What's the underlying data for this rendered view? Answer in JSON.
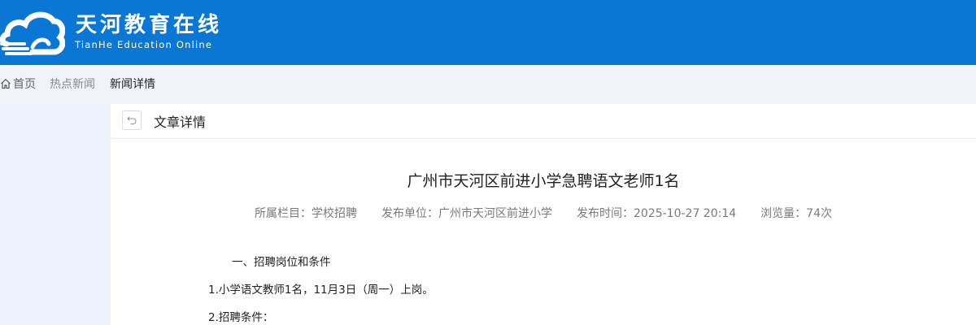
{
  "header": {
    "brand_cn": "天河教育在线",
    "brand_en": "TianHe Education Online",
    "logo_icon": "cloud-logo-icon",
    "bg_color": "#0a77d5"
  },
  "breadcrumb": {
    "home_label": "首页",
    "home_icon": "home-icon",
    "hot_news_label": "热点新闻",
    "current_label": "新闻详情"
  },
  "card": {
    "back_icon": "undo-arrow-icon",
    "header_title": "文章详情"
  },
  "article": {
    "title": "广州市天河区前进小学急聘语文老师1名",
    "meta": {
      "category": "所属栏目：学校招聘",
      "publisher": "发布单位：广州市天河区前进小学",
      "publish_time": "发布时间：2025-10-27 20:14",
      "views": "浏览量：74次"
    },
    "paragraphs": [
      "一、招聘岗位和条件",
      "1.小学语文教师1名，11月3日（周一）上岗。",
      "2.招聘条件："
    ]
  }
}
